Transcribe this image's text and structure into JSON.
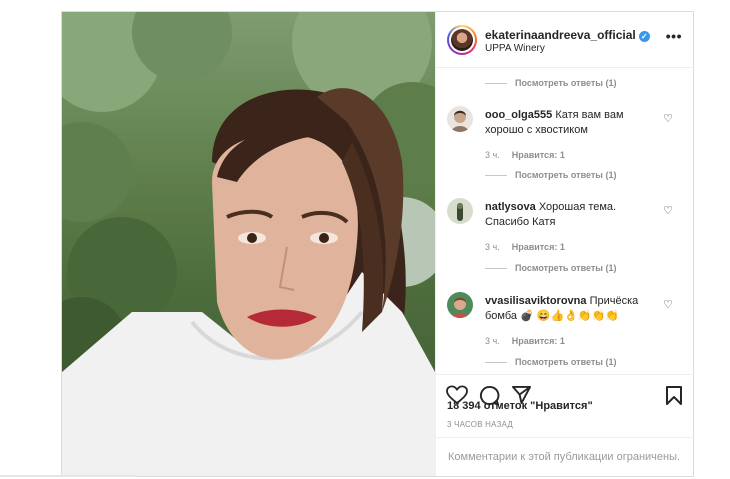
{
  "post": {
    "username": "ekaterinaandreeva_official",
    "location": "UPPA Winery",
    "likes_text": "18 394 отметок \"Нравится\"",
    "time_text": "3 ЧАСОВ НАЗАД",
    "comments_restricted": "Комментарии к этой публикации ограничены."
  },
  "comments": [
    {
      "view_replies": "Посмотреть ответы (1)"
    },
    {
      "username": "ooo_olga555",
      "text": "Катя вам вам хорошо с хвостиком",
      "time": "3 ч.",
      "likes": "Нравится: 1",
      "view_replies": "Посмотреть ответы (1)"
    },
    {
      "username": "natlysova",
      "text": "Хорошая тема. Спасибо Катя",
      "time": "3 ч.",
      "likes": "Нравится: 1",
      "view_replies": "Посмотреть ответы (1)"
    },
    {
      "username": "vvasilisaviktorovna",
      "text": "Причёска бомба 💣 😄👍👌👏👏👏",
      "time": "3 ч.",
      "likes": "Нравится: 1",
      "view_replies": "Посмотреть ответы (1)"
    }
  ],
  "icons": {
    "verified": "verified-badge-icon",
    "more": "more-options-icon",
    "like": "heart-icon",
    "comment": "comment-icon",
    "share": "paper-plane-icon",
    "save": "bookmark-icon"
  },
  "colors": {
    "verified": "#3897f0",
    "muted": "#8e8e8e",
    "text": "#262626",
    "border": "#dbdbdb"
  }
}
